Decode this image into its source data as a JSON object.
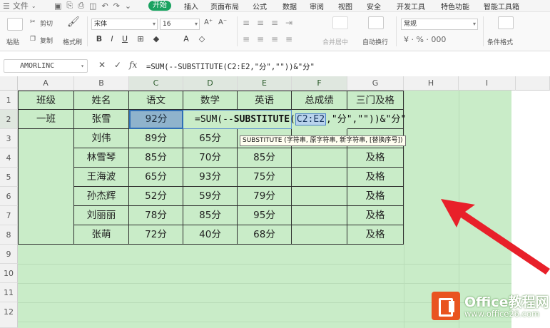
{
  "menu": {
    "file": "文件",
    "tabs": [
      "开始",
      "插入",
      "页面布局",
      "公式",
      "数据",
      "审阅",
      "视图",
      "安全",
      "开发工具",
      "特色功能",
      "智能工具箱"
    ]
  },
  "ribbon": {
    "paste": "粘贴",
    "cut": "剪切",
    "copy": "复制",
    "format_painter": "格式刷",
    "font_name": "宋体",
    "font_size": "16",
    "merge_center": "合并居中",
    "wrap_text": "自动换行",
    "number_format": "常规",
    "conditional_format": "条件格式",
    "bold": "B",
    "italic": "I",
    "underline": "U",
    "font_color": "A"
  },
  "formula_bar": {
    "name_box": "AMORLINC",
    "cancel": "✕",
    "confirm": "✓",
    "fx": "fx",
    "formula": "=SUM(--SUBSTITUTE(C2:E2,\"分\",\"\"))&\"分\""
  },
  "columns": [
    "A",
    "B",
    "C",
    "D",
    "E",
    "F",
    "G",
    "H",
    "I"
  ],
  "rows": [
    "1",
    "2",
    "3",
    "4",
    "5",
    "6",
    "7",
    "8",
    "9",
    "10",
    "11",
    "12"
  ],
  "table": {
    "headers": [
      "班级",
      "姓名",
      "语文",
      "数学",
      "英语",
      "总成绩",
      "三门及格"
    ],
    "class_label": "一班",
    "data": [
      {
        "name": "张雪",
        "chinese": "92分",
        "math": "",
        "english": "",
        "total": "",
        "pass": ""
      },
      {
        "name": "刘伟",
        "chinese": "89分",
        "math": "65分",
        "english": "",
        "total": "",
        "pass": ""
      },
      {
        "name": "林雪琴",
        "chinese": "85分",
        "math": "70分",
        "english": "85分",
        "total": "",
        "pass": "及格"
      },
      {
        "name": "王海波",
        "chinese": "65分",
        "math": "93分",
        "english": "75分",
        "total": "",
        "pass": "及格"
      },
      {
        "name": "孙杰辉",
        "chinese": "52分",
        "math": "59分",
        "english": "79分",
        "total": "",
        "pass": "及格"
      },
      {
        "name": "刘丽丽",
        "chinese": "78分",
        "math": "85分",
        "english": "95分",
        "total": "",
        "pass": "及格"
      },
      {
        "name": "张萌",
        "chinese": "72分",
        "math": "40分",
        "english": "68分",
        "total": "",
        "pass": "及格"
      }
    ]
  },
  "inline_formula": {
    "prefix": "=SUM(--",
    "fn": "SUBSTITUTE",
    "open": "(",
    "ref": "C2:E2",
    "rest": ",\"分\",\"\"))&\"分\""
  },
  "tooltip": "SUBSTITUTE (字符串, 原字符串, 新字符串, [替换序号])",
  "watermark": {
    "brand": "Office教程网",
    "url": "www.office26.com"
  },
  "colors": {
    "sheet_bg": "#c9ecc8",
    "accent": "#1aa260",
    "arrow": "#e8202a",
    "logo": "#e95420"
  }
}
